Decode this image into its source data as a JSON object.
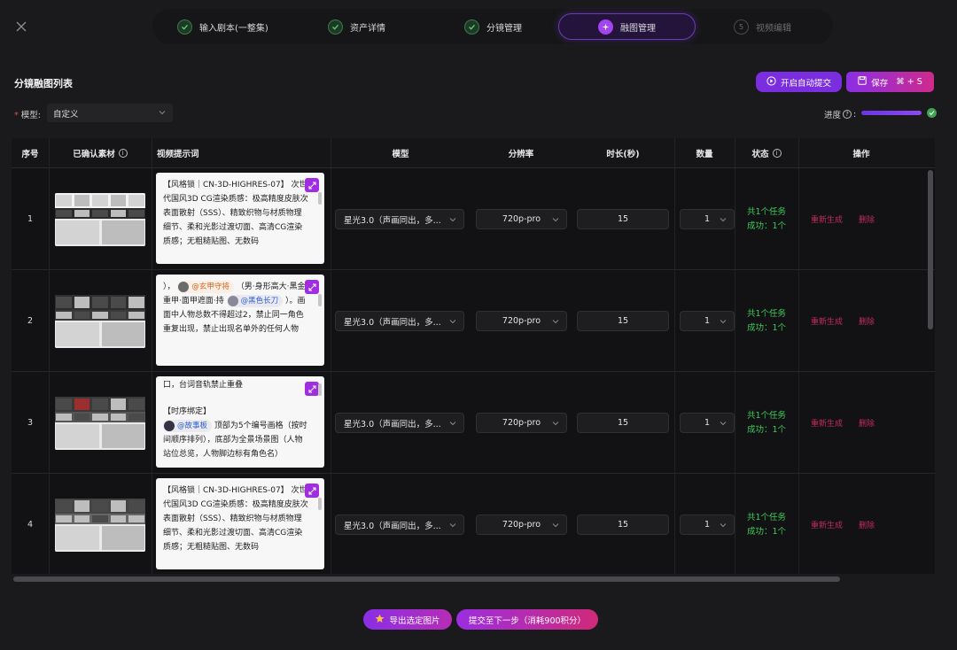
{
  "steps": [
    {
      "label": "输入剧本(一整集)",
      "state": "done"
    },
    {
      "label": "资产详情",
      "state": "done"
    },
    {
      "label": "分镜管理",
      "state": "done"
    },
    {
      "label": "融图管理",
      "state": "active"
    },
    {
      "label": "视频编辑",
      "state": "pending",
      "number": "5"
    }
  ],
  "header": {
    "title": "分镜融图列表",
    "auto_submit_label": "开启自动提交",
    "save_label": "保存",
    "save_shortcut": "⌘ + S"
  },
  "filters": {
    "model_label": "模型:",
    "model_value": "自定义",
    "progress_label": "进度",
    "progress_fraction": 1.0
  },
  "table": {
    "columns": [
      "序号",
      "已确认素材",
      "视频提示词",
      "模型",
      "分辨率",
      "时长(秒)",
      "数量",
      "状态",
      "操作"
    ],
    "rows": [
      {
        "index": "1",
        "prompt": "【风格锁｜CN-3D-HIGHRES-07】 次世代国风3D CG渲染质感：极高精度皮肤次表面散射（SSS）、精致织物与材质物理细节、柔和光影过渡切面、高清CG渲染质感；无粗糙贴图、无数码",
        "model": "星光3.0（声画同出，多...",
        "resolution": "720p-pro",
        "duration": "15",
        "count": "1",
        "status_total": "共1个任务",
        "status_success": "成功：1个",
        "regen": "重新生成",
        "delete": "删除"
      },
      {
        "index": "2",
        "prompt_before": "），",
        "tag1": "@玄甲守将",
        "prompt_mid": "（男·身形高大·黑金重甲·面甲遮面·持",
        "tag2": "@黑色长刀",
        "prompt_after": "）。画面中人物总数不得超过2，禁止同一角色重复出现，禁止出现名单外的任何人物",
        "model": "星光3.0（声画同出，多...",
        "resolution": "720p-pro",
        "duration": "15",
        "count": "1",
        "status_total": "共1个任务",
        "status_success": "成功：1个",
        "regen": "重新生成",
        "delete": "删除"
      },
      {
        "index": "3",
        "prompt_line1": "口，台词音轨禁止重叠",
        "prompt_line2": "【时序绑定】",
        "tag1": "@故事板",
        "prompt_after": "顶部为5个编号画格（按时间顺序排列），底部为全景场景图（人物站位总览，人物脚边标有角色名）",
        "model": "星光3.0（声画同出，多...",
        "resolution": "720p-pro",
        "duration": "15",
        "count": "1",
        "status_total": "共1个任务",
        "status_success": "成功：1个",
        "regen": "重新生成",
        "delete": "删除"
      },
      {
        "index": "4",
        "prompt": "【风格锁｜CN-3D-HIGHRES-07】 次世代国风3D CG渲染质感：极高精度皮肤次表面散射（SSS）、精致织物与材质物理细节、柔和光影过渡切面、高清CG渲染质感；无粗糙贴图、无数码",
        "model": "星光3.0（声画同出，多...",
        "resolution": "720p-pro",
        "duration": "15",
        "count": "1",
        "status_total": "共1个任务",
        "status_success": "成功：1个",
        "regen": "重新生成",
        "delete": "删除"
      }
    ]
  },
  "footer": {
    "export_label": "导出选定图片",
    "next_label": "提交至下一步（消耗900积分）"
  },
  "colors": {
    "accent_purple": "#8a2ee6",
    "accent_pink": "#d02a8c",
    "success_green": "#3ec95a",
    "danger_red": "#c02d5a"
  }
}
